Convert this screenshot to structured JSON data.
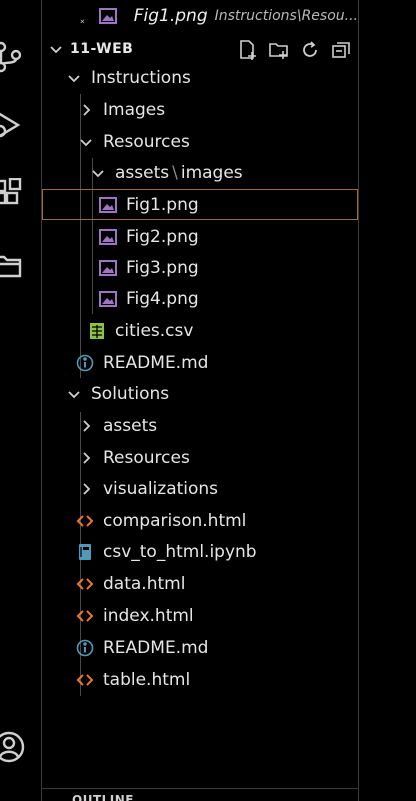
{
  "open_editor": {
    "file_name": "Fig1.png",
    "path_hint": "Instructions\\Resou..."
  },
  "explorer": {
    "section_title": "11-WEB",
    "actions": [
      "new-file-icon",
      "new-folder-icon",
      "refresh-icon",
      "collapse-all-icon"
    ]
  },
  "tree": {
    "instructions": "Instructions",
    "images": "Images",
    "resources": "Resources",
    "assets": "assets",
    "assets_sep": "\\",
    "assets_images": "images",
    "fig1": "Fig1.png",
    "fig2": "Fig2.png",
    "fig3": "Fig3.png",
    "fig4": "Fig4.png",
    "cities": "cities.csv",
    "readme1": "README.md",
    "solutions": "Solutions",
    "sol_assets": "assets",
    "sol_resources": "Resources",
    "visualizations": "visualizations",
    "comparison": "comparison.html",
    "csv_to_html": "csv_to_html.ipynb",
    "data_html": "data.html",
    "index_html": "index.html",
    "readme2": "README.md",
    "table_html": "table.html"
  },
  "outline": {
    "title": "OUTLINE"
  },
  "colors": {
    "image_icon": "#a074c4",
    "html_icon": "#e37933",
    "csv_icon": "#8dc149",
    "info_icon": "#519aba",
    "notebook_icon": "#519aba",
    "selected_border": "#a0683c"
  }
}
